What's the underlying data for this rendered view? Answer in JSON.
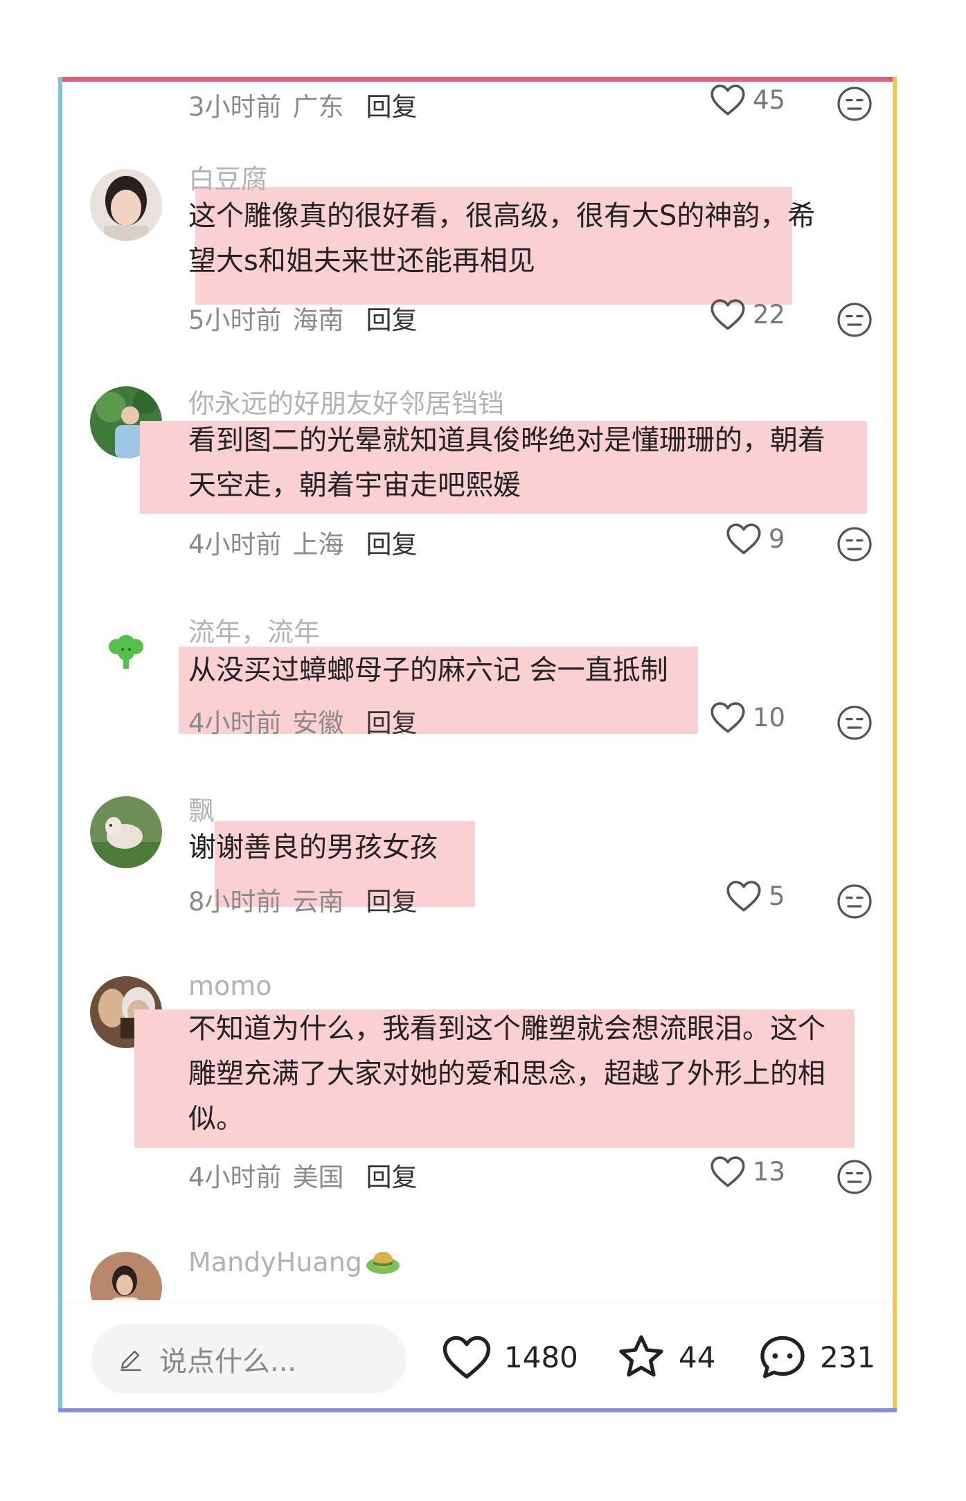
{
  "top_meta": {
    "time": "3小时前",
    "region": "广东",
    "reply": "回复",
    "likes": "45"
  },
  "comments": [
    {
      "name": "白豆腐",
      "line1": "这个雕像真的很好看，很高级，很有大S的神韵，希",
      "line2": "望大s和姐夫来世还能再相见",
      "line3": "",
      "time": "5小时前",
      "region": "海南",
      "reply": "回复",
      "likes": "22"
    },
    {
      "name": "你永远的好朋友好邻居铛铛",
      "line1": "看到图二的光晕就知道具俊晔绝对是懂珊珊的，朝着",
      "line2": "天空走，朝着宇宙走吧熙媛",
      "line3": "",
      "time": "4小时前",
      "region": "上海",
      "reply": "回复",
      "likes": "9"
    },
    {
      "name": "流年，流年",
      "line1": "从没买过蟑螂母子的麻六记 会一直抵制",
      "line2": "",
      "line3": "",
      "time": "4小时前",
      "region": "安徽",
      "reply": "回复",
      "likes": "10"
    },
    {
      "name": "飘",
      "line1": "谢谢善良的男孩女孩",
      "line2": "",
      "line3": "",
      "time": "8小时前",
      "region": "云南",
      "reply": "回复",
      "likes": "5"
    },
    {
      "name": "momo",
      "line1": "不知道为什么，我看到这个雕塑就会想流眼泪。这个",
      "line2": "雕塑充满了大家对她的爱和思念，超越了外形上的相",
      "line3": "似。",
      "time": "4小时前",
      "region": "美国",
      "reply": "回复",
      "likes": "13"
    },
    {
      "name": "MandyHuang",
      "line1": "",
      "line2": "",
      "line3": "",
      "time": "",
      "region": "",
      "reply": "",
      "likes": ""
    }
  ],
  "bottom_bar": {
    "placeholder": "说点什么...",
    "likes": "1480",
    "favorites": "44",
    "comments": "231"
  },
  "icons": {
    "like": "heart-icon",
    "dislike": "neutral-face-icon",
    "edit": "pencil-icon",
    "favorite": "star-icon",
    "comment": "chat-bubble-icon"
  },
  "colors": {
    "frame_top": "#e15e74",
    "frame_left": "#7bc5d6",
    "frame_right": "#f0c84a",
    "frame_bottom": "#7f8ede",
    "highlight": "#fbd0d2"
  }
}
